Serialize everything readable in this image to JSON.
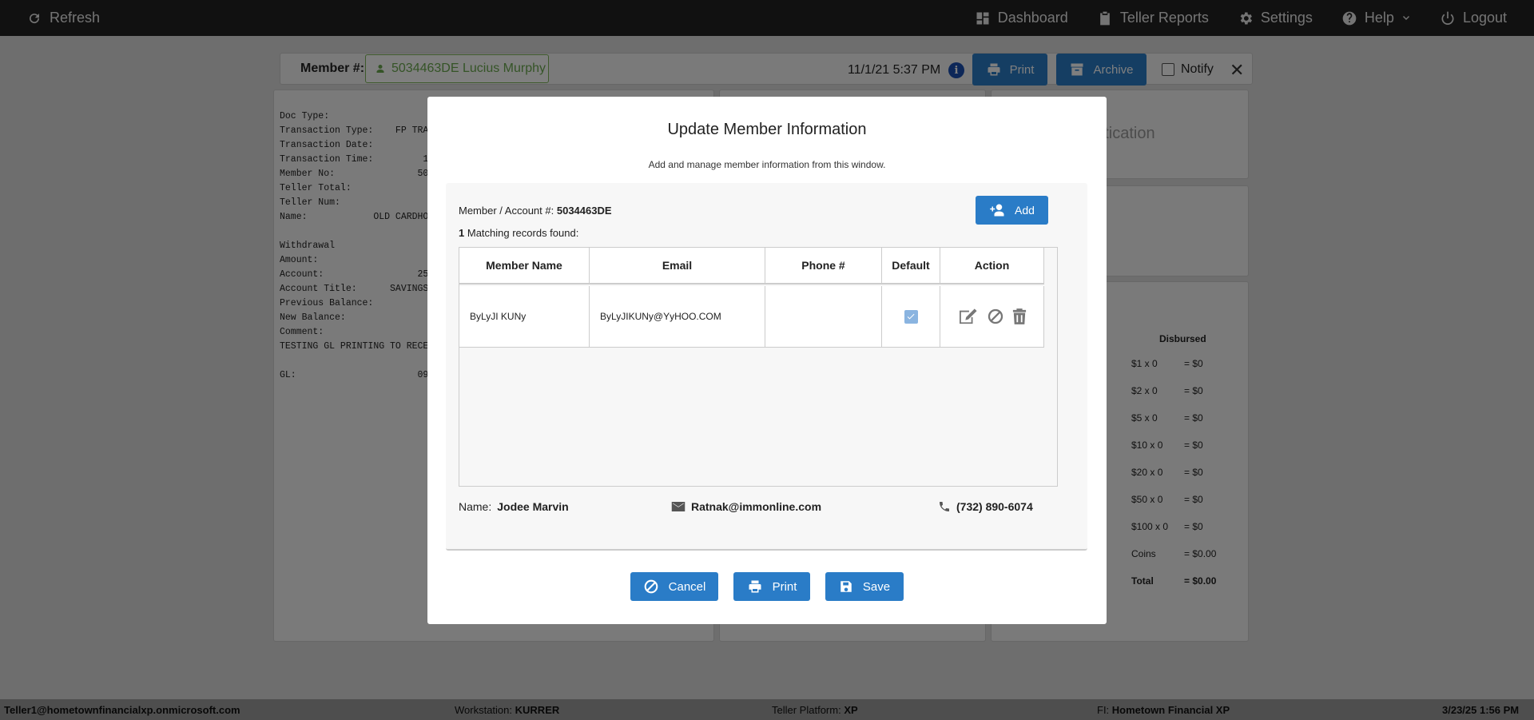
{
  "topbar": {
    "refresh_label": "Refresh",
    "nav": [
      {
        "label": "Dashboard",
        "icon": "dashboard-icon"
      },
      {
        "label": "Teller Reports",
        "icon": "clipboard-icon"
      },
      {
        "label": "Settings",
        "icon": "gear-icon"
      },
      {
        "label": "Help",
        "icon": "help-icon"
      },
      {
        "label": "Logout",
        "icon": "power-icon"
      }
    ]
  },
  "member_bar": {
    "label": "Member #:",
    "member_value": "5034463DE Lucius Murphy",
    "datetime": "11/1/21 5:37 PM",
    "info_icon_text": "i",
    "print_label": "Print",
    "archive_label": "Archive",
    "notify_label": "Notify"
  },
  "receipt": {
    "lines": "Doc Type:\nTransaction Type:    FP TRAN\nTransaction Date:\nTransaction Time:         1\nMember No:               50\nTeller Total:\nTeller Num:\nName:            OLD CARDHO\n\nWithdrawal\nAmount:\nAccount:                 25\nAccount Title:      SAVINGS\nPrevious Balance:\nNew Balance:\nComment:\nTESTING GL PRINTING TO RECEI\n\nGL:                      09"
  },
  "auth_panel": {
    "title_fragment": "entication"
  },
  "cash_panel": {
    "header": "Disbursed",
    "rows": [
      {
        "denom": "$1 x 0",
        "total": "= $0"
      },
      {
        "denom": "$2 x 0",
        "total": "= $0"
      },
      {
        "denom": "$5 x 0",
        "total": "= $0"
      },
      {
        "denom": "$10 x 0",
        "total": "= $0"
      },
      {
        "denom": "$20 x 0",
        "total": "= $0"
      },
      {
        "denom": "$50 x 0",
        "total": "= $0"
      },
      {
        "denom": "$100 x 0",
        "total": "= $0"
      },
      {
        "denom": "Coins",
        "total": "= $0.00"
      },
      {
        "denom": "Total",
        "total": "= $0.00"
      }
    ]
  },
  "modal": {
    "title": "Update Member Information",
    "subtitle": "Add and manage member information from this window.",
    "account_label": "Member / Account #:",
    "account_value": "5034463DE",
    "match_count": "1",
    "match_text": "Matching records found:",
    "add_label": "Add",
    "table": {
      "columns": [
        "Member Name",
        "Email",
        "Phone #",
        "Default",
        "Action"
      ],
      "rows": [
        {
          "name": "ByLyJI KUNy",
          "email": "ByLyJIKUNy@YyHOO.COM",
          "phone": "",
          "default": true
        }
      ]
    },
    "contact": {
      "name_label": "Name:",
      "name_value": "Jodee Marvin",
      "email_value": "Ratnak@immonline.com",
      "phone_value": "(732) 890-6074"
    },
    "buttons": {
      "cancel": "Cancel",
      "print": "Print",
      "save": "Save"
    }
  },
  "footer": {
    "user": "Teller1@hometownfinancialxp.onmicrosoft.com",
    "workstation_label": "Workstation:",
    "workstation_value": "KURRER",
    "platform_label": "Teller Platform:",
    "platform_value": "XP",
    "fi_label": "FI:",
    "fi_value": "Hometown Financial XP",
    "datetime": "3/23/25 1:56 PM"
  },
  "colors": {
    "primary": "#2a7cc7",
    "topbar": "#222222",
    "member_green": "#6aa84f"
  }
}
